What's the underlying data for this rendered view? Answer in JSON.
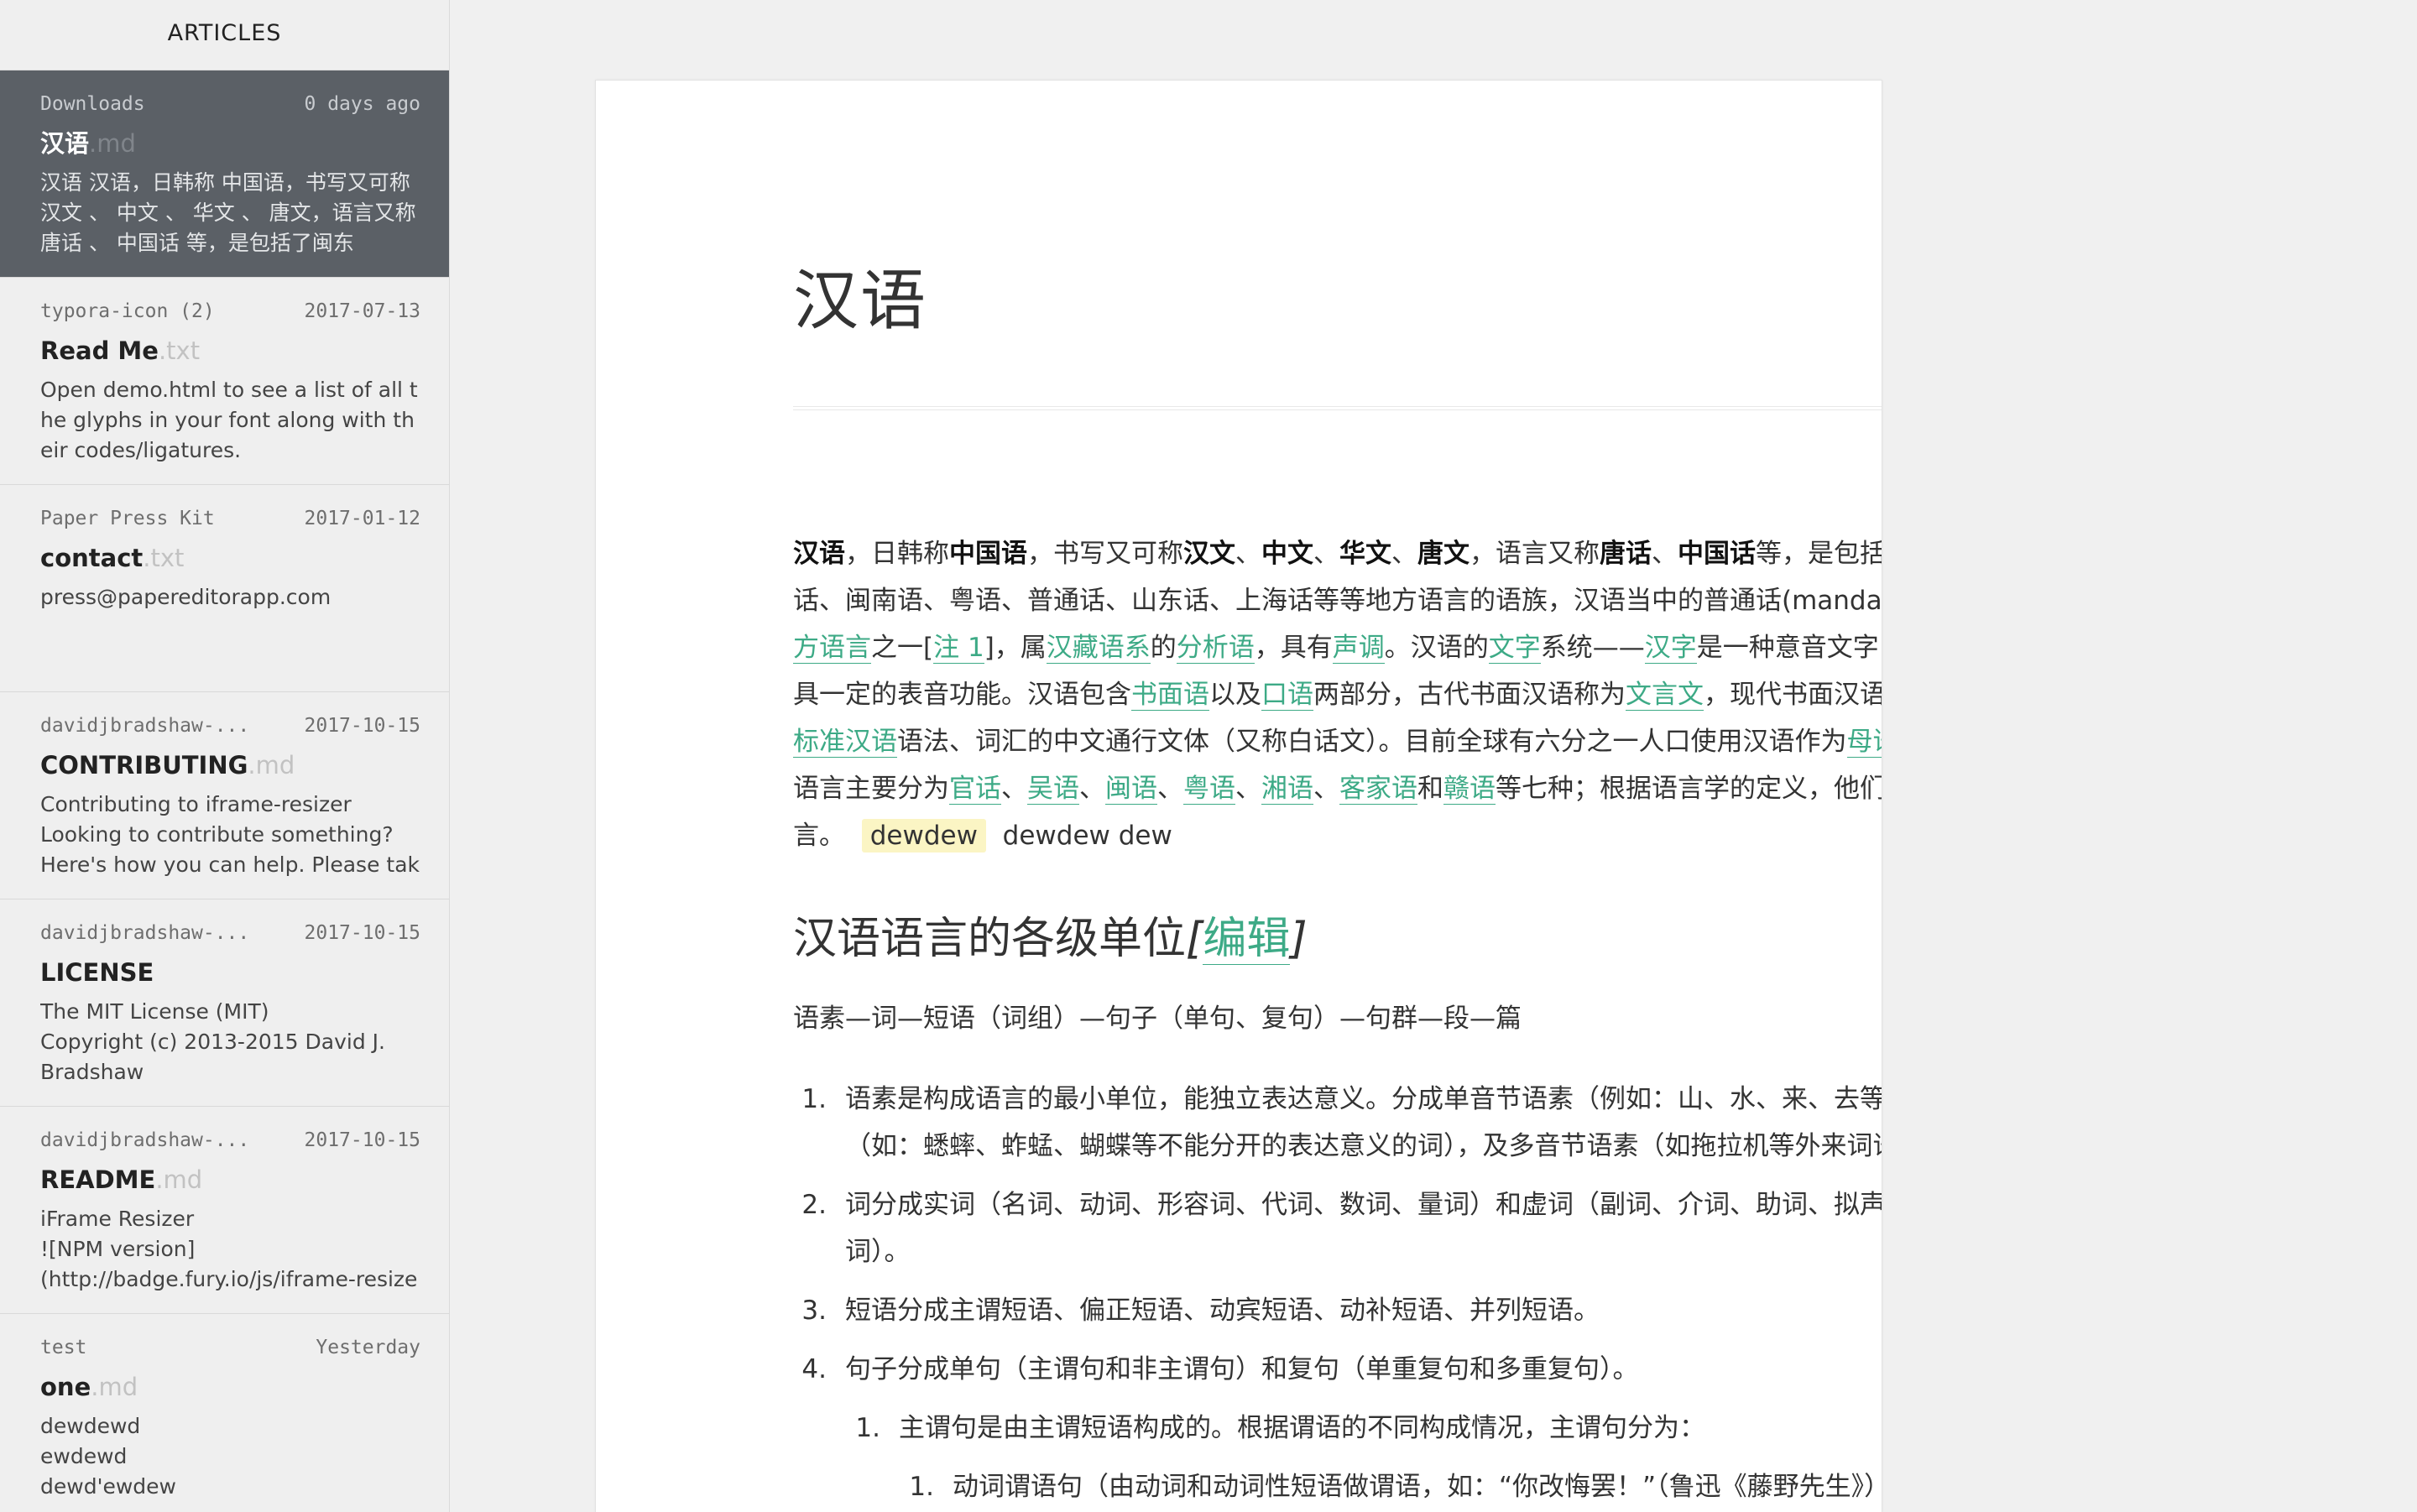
{
  "sidebar": {
    "header": "ARTICLES",
    "articles": [
      {
        "folder": "Downloads",
        "date": "0 days ago",
        "title": "汉语",
        "ext": ".md",
        "excerpt": "汉语 汉语，日韩称 中国语，书写又可称 汉文 、 中文 、 华文 、 唐文，语言又称 唐话 、 中国话 等，是包括了闽东"
      },
      {
        "folder": "typora-icon (2)",
        "date": "2017-07-13",
        "title": "Read Me",
        "ext": ".txt",
        "excerpt": "Open demo.html to see a list of all the glyphs in your font along with their codes/ligatures."
      },
      {
        "folder": "Paper Press Kit",
        "date": "2017-01-12",
        "title": "contact",
        "ext": ".txt",
        "excerpt": "press@papereditorapp.com"
      },
      {
        "folder": "davidjbradshaw-...",
        "date": "2017-10-15",
        "title": "CONTRIBUTING",
        "ext": ".md",
        "excerpt": "Contributing to iframe-resizer\nLooking to contribute something?\nHere's how you can help. Please take a"
      },
      {
        "folder": "davidjbradshaw-...",
        "date": "2017-10-15",
        "title": "LICENSE",
        "ext": "",
        "excerpt": "The MIT License (MIT)\nCopyright (c) 2013-2015 David J.\nBradshaw"
      },
      {
        "folder": "davidjbradshaw-...",
        "date": "2017-10-15",
        "title": "README",
        "ext": ".md",
        "excerpt": "iFrame Resizer\n![NPM version]\n(http://badge.fury.io/js/iframe-resizer)"
      },
      {
        "folder": "test",
        "date": "Yesterday",
        "title": "one",
        "ext": ".md",
        "excerpt": "dewdewd\newdewd\ndewd'ewdew"
      }
    ]
  },
  "doc": {
    "title": "汉语",
    "p1": {
      "s1": "汉语",
      "s2": "，日韩称",
      "s3": "中国语",
      "s4": "，书写又可称",
      "s5": "汉文",
      "s6": "、",
      "s7": "中文",
      "s8": "、",
      "s9": "华文",
      "s10": "、",
      "s11": "唐文",
      "s12": "，语言又称",
      "s13": "唐话",
      "s14": "、",
      "s15": "中国话",
      "s16": "等，是包括了闽东话、客家话、闽南语、粤语、普通话、山东话、上海话等等地方语言的语族，汉语当中的普通话(mandarin)是",
      "l1": "联合国官方语言",
      "s17": "之一[",
      "l2": "注 1",
      "s18": "]，属",
      "l3": "汉藏语系",
      "s19": "的",
      "l4": "分析语",
      "s20": "，具有",
      "l5": "声调",
      "s21": "。汉语的",
      "l6": "文字",
      "s22": "系统——",
      "l7": "汉字",
      "s23": "是一种意音文字，表意的同时也具一定的表音功能。汉语包含",
      "l8": "书面语",
      "s24": "以及",
      "l9": "口语",
      "s25": "两部分，古代书面汉语称为",
      "l10": "文言文",
      "s26": "，现代书面汉语一般指使用",
      "l11": "现代标准汉语",
      "s27": "语法、词汇的中文通行文体（又称白话文）。目前全球有六分之一人口使用汉语作为",
      "l12": "母语",
      "s28": "。汉语内部的语言主要分为",
      "l13": "官话",
      "s29": "、",
      "l14": "吴语",
      "s30": "、",
      "l15": "闽语",
      "s31": "、",
      "l16": "粤语",
      "s32": "、",
      "l17": "湘语",
      "s33": "、",
      "l18": "客家语",
      "s34": "和",
      "l19": "赣语",
      "s35": "等七种；根据语言学的定义，他们都是是独立的语言。",
      "hl": "dewdew",
      "tail": "dewdew dew"
    },
    "h2": {
      "text": "汉语语言的各级单位",
      "open": "[",
      "link": "编辑",
      "close": "]"
    },
    "p2": "语素—词—短语（词组）—句子（单句、复句）—句群—段—篇",
    "list": [
      {
        "num": "1.",
        "text": "语素是构成语言的最小单位，能独立表达意义。分成单音节语素（例如：山、水、来、去等），和双音节（如：蟋蟀、蚱蜢、蝴蝶等不能分开的表达意义的词），及多音节语素（如拖拉机等外来词语）。"
      },
      {
        "num": "2.",
        "text": "词分成实词（名词、动词、形容词、代词、数词、量词）和虚词（副词、介词、助词、拟声词、叹词、连词）。"
      },
      {
        "num": "3.",
        "text": "短语分成主谓短语、偏正短语、动宾短语、动补短语、并列短语。"
      },
      {
        "num": "4.",
        "text": "句子分成单句（主谓句和非主谓句）和复句（单重复句和多重复句）。"
      }
    ],
    "sub": {
      "num": "1.",
      "text": "主谓句是由主谓短语构成的。根据谓语的不同构成情况，主谓句分为："
    },
    "subsub": {
      "num": "1.",
      "text": "动词谓语句（由动词和动词性短语做谓语，如：“你改悔罢！”（鲁迅《藤野先生》）“我就往仙台的医学专修学校去。”（鲁迅《藤野先生》））"
    }
  },
  "colors": {
    "link": "#3daa86",
    "active_article_bg": "#5b6066",
    "highlight": "#fbf5c4"
  }
}
